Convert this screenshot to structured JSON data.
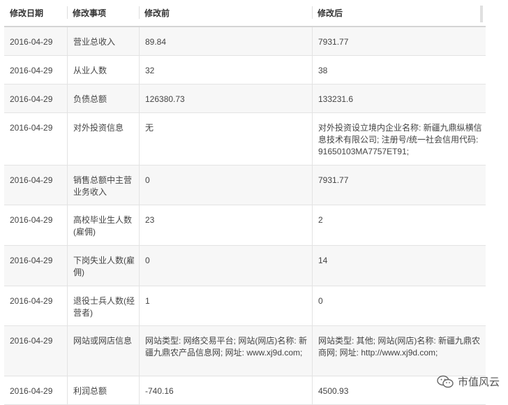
{
  "columns": [
    "修改日期",
    "修改事项",
    "修改前",
    "修改后"
  ],
  "rows": [
    {
      "date": "2016-04-29",
      "item": "营业总收入",
      "before": "89.84",
      "after": "7931.77"
    },
    {
      "date": "2016-04-29",
      "item": "从业人数",
      "before": "32",
      "after": "38"
    },
    {
      "date": "2016-04-29",
      "item": "负债总额",
      "before": "126380.73",
      "after": "133231.6"
    },
    {
      "date": "2016-04-29",
      "item": "对外投资信息",
      "before": "无",
      "after": "对外投资设立境内企业名称: 新疆九鼎纵横信息技术有限公司; 注册号/统一社会信用代码: 91650103MA7757ET91;"
    },
    {
      "date": "2016-04-29",
      "item": "销售总额中主营业务收入",
      "before": "0",
      "after": "7931.77"
    },
    {
      "date": "2016-04-29",
      "item": "高校毕业生人数(雇佣)",
      "before": "23",
      "after": "2"
    },
    {
      "date": "2016-04-29",
      "item": "下岗失业人数(雇佣)",
      "before": "0",
      "after": "14"
    },
    {
      "date": "2016-04-29",
      "item": "退役士兵人数(经营者)",
      "before": "1",
      "after": "0"
    },
    {
      "date": "2016-04-29",
      "item": "网站或网店信息",
      "before": "网站类型: 网络交易平台; 网站(网店)名称: 新疆九鼎农产品信息网; 网址: www.xj9d.com;",
      "after": "网站类型: 其他; 网站(网店)名称: 新疆九鼎农商网; 网址: http://www.xj9d.com;"
    },
    {
      "date": "2016-04-29",
      "item": "利润总额",
      "before": "-740.16",
      "after": "4500.93"
    }
  ],
  "watermark": {
    "text": "市值风云",
    "icon": "wechat-icon"
  }
}
